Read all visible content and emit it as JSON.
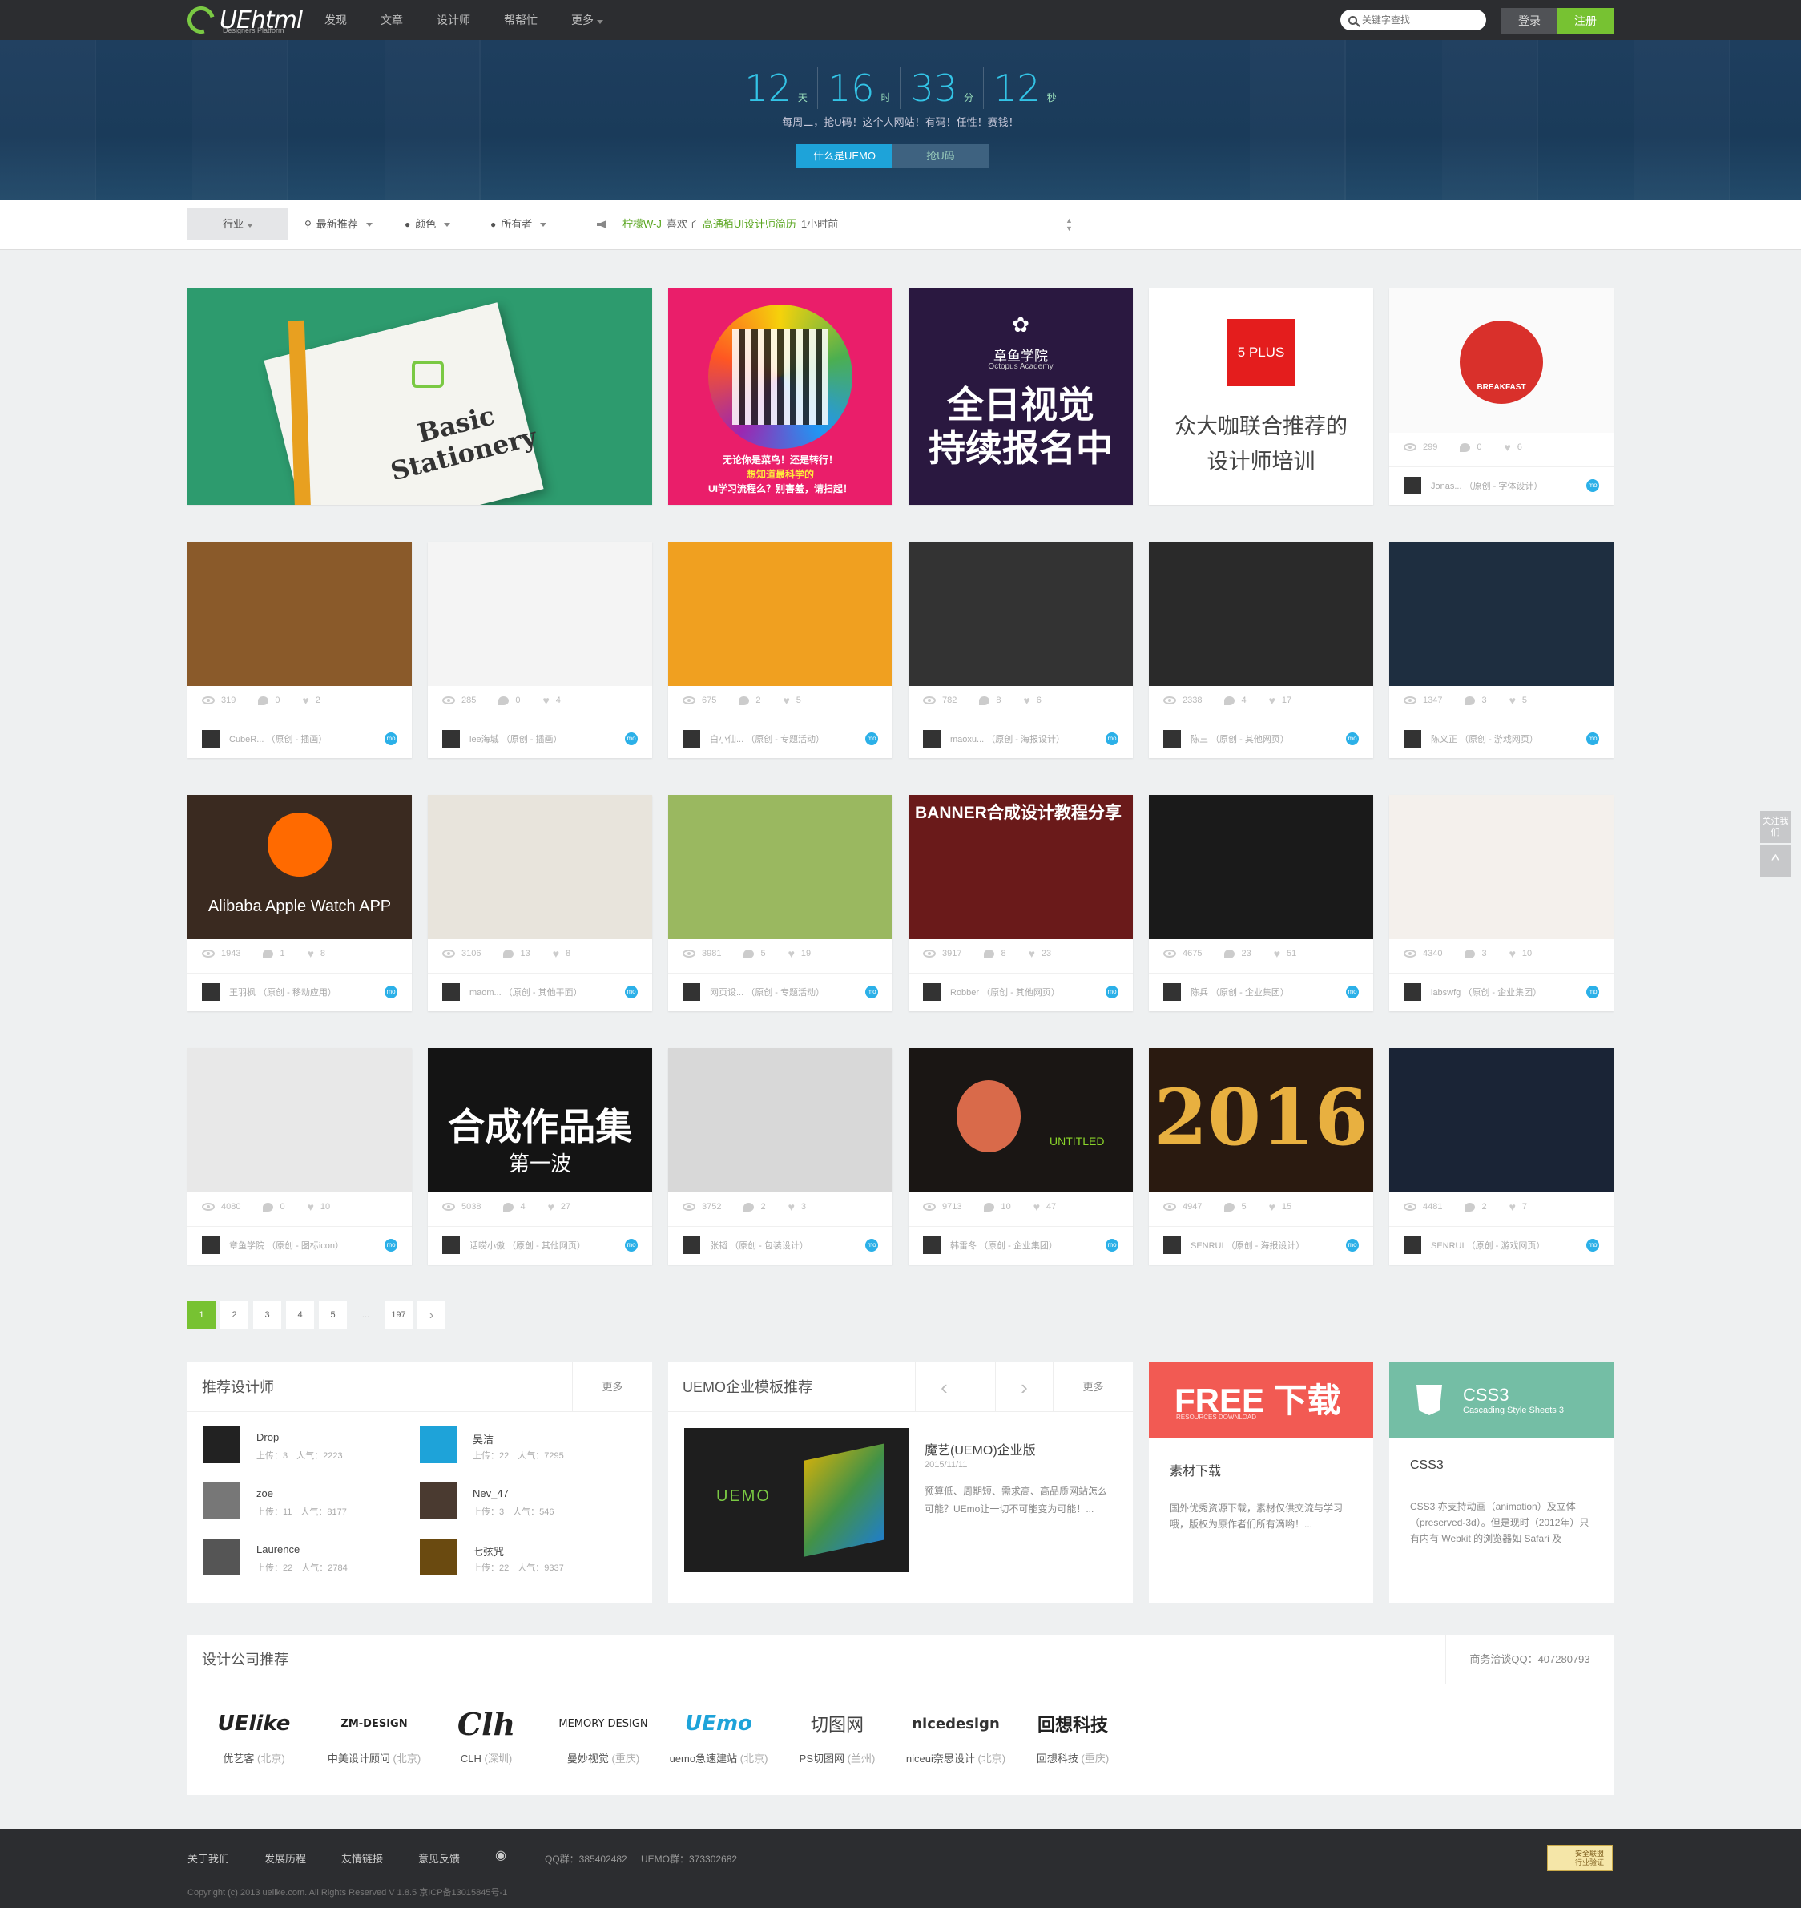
{
  "header": {
    "logo_text": "UEhtml",
    "logo_sub": "Designers Platform",
    "nav": [
      "发现",
      "文章",
      "设计师",
      "帮帮忙",
      "更多"
    ],
    "search_placeholder": "关键字查找",
    "login": "登录",
    "register": "注册"
  },
  "banner": {
    "countdown": [
      {
        "n": "12",
        "u": "天"
      },
      {
        "n": "16",
        "u": "时"
      },
      {
        "n": "33",
        "u": "分"
      },
      {
        "n": "12",
        "u": "秒"
      }
    ],
    "tagline": "每周二，抢U码！这个人网站！有码！任性！赛钱！",
    "btn_what": "什么是UEMO",
    "btn_grab": "抢U码"
  },
  "filter": {
    "industry": "行业",
    "latest": "最新推荐",
    "color": "颜色",
    "owner": "所有者",
    "activity_user": "柠檬W-J",
    "activity_verb": "喜欢了",
    "activity_item": "高通栢UI设计师简历",
    "activity_time": "1小时前"
  },
  "featured": {
    "stationery_title": "Basic Stationery",
    "qr_caption_1": "无论你是菜鸟！还是转行！",
    "qr_caption_2": "想知道最科学的",
    "qr_caption_3": "UI学习流程么？别害羞，请扫起！",
    "octopus_name": "章鱼学院",
    "octopus_en": "Octopus Academy",
    "octopus_line1": "全日视觉",
    "octopus_line2": "持续报名中",
    "plus_badge": "5 PLUS",
    "plus_line1": "众大咖联合推荐的",
    "plus_line2": "设计师培训",
    "breakfast_label": "BREAKFAST",
    "breakfast_stats": {
      "views": "299",
      "comments": "0",
      "likes": "6"
    },
    "breakfast_meta": {
      "author": "Jonas...",
      "tag": "（原创 - 字体设计）"
    }
  },
  "cards": [
    {
      "views": "319",
      "comments": "0",
      "likes": "2",
      "author": "CubeR...",
      "tag": "（原创 - 插画）",
      "color": "#8a5a2a"
    },
    {
      "views": "285",
      "comments": "0",
      "likes": "4",
      "author": "lee海城",
      "tag": "（原创 - 插画）",
      "color": "#f4f4f4"
    },
    {
      "views": "675",
      "comments": "2",
      "likes": "5",
      "author": "白小仙...",
      "tag": "（原创 - 专题活动）",
      "color": "#f0a020"
    },
    {
      "views": "782",
      "comments": "8",
      "likes": "6",
      "author": "maoxu...",
      "tag": "（原创 - 海报设计）",
      "color": "#333"
    },
    {
      "views": "2338",
      "comments": "4",
      "likes": "17",
      "author": "陈三",
      "tag": "（原创 - 其他网页）",
      "color": "#2a2a2a"
    },
    {
      "views": "1347",
      "comments": "3",
      "likes": "5",
      "author": "陈义正",
      "tag": "（原创 - 游戏网页）",
      "color": "#1e2e40"
    },
    {
      "views": "1943",
      "comments": "1",
      "likes": "8",
      "author": "王羽枫",
      "tag": "（原创 - 移动应用）",
      "color": "#3a2a20"
    },
    {
      "views": "3106",
      "comments": "13",
      "likes": "8",
      "author": "maom...",
      "tag": "（原创 - 其他平面）",
      "color": "#e8e4dc"
    },
    {
      "views": "3981",
      "comments": "5",
      "likes": "19",
      "author": "网页设...",
      "tag": "（原创 - 专题活动）",
      "color": "#9ab860"
    },
    {
      "views": "3917",
      "comments": "8",
      "likes": "23",
      "author": "Robber",
      "tag": "（原创 - 其他网页）",
      "color": "#6a1a1a"
    },
    {
      "views": "4675",
      "comments": "23",
      "likes": "51",
      "author": "陈兵",
      "tag": "（原创 - 企业集团）",
      "color": "#1a1a1a"
    },
    {
      "views": "4340",
      "comments": "3",
      "likes": "10",
      "author": "iabswfg",
      "tag": "（原创 - 企业集团）",
      "color": "#f4f0ec"
    },
    {
      "views": "4080",
      "comments": "0",
      "likes": "10",
      "author": "章鱼学院",
      "tag": "（原创 - 图标icon）",
      "color": "#e8e8e8"
    },
    {
      "views": "5038",
      "comments": "4",
      "likes": "27",
      "author": "话唠小傲",
      "tag": "（原创 - 其他网页）",
      "color": "#141414"
    },
    {
      "views": "3752",
      "comments": "2",
      "likes": "3",
      "author": "张韬",
      "tag": "（原创 - 包装设计）",
      "color": "#d8d8d8"
    },
    {
      "views": "9713",
      "comments": "10",
      "likes": "47",
      "author": "韩雷冬",
      "tag": "（原创 - 企业集团）",
      "color": "#1a1614"
    },
    {
      "views": "4947",
      "comments": "5",
      "likes": "15",
      "author": "SENRUI",
      "tag": "（原创 - 海报设计）",
      "color": "#2a1a10"
    },
    {
      "views": "4481",
      "comments": "2",
      "likes": "7",
      "author": "SENRUI",
      "tag": "（原创 - 游戏网页）",
      "color": "#1a2436"
    }
  ],
  "card_texts": {
    "alibaba": "Alibaba Apple Watch APP",
    "banner_tut": "BANNER合成设计教程分享",
    "synth_1": "合成作品集",
    "synth_2": "第一波",
    "untitled": "UNTITLED",
    "year": "2016"
  },
  "pager": [
    "1",
    "2",
    "3",
    "4",
    "5",
    "...",
    "197"
  ],
  "designers_panel": {
    "title": "推荐设计师",
    "more": "更多",
    "items": [
      {
        "name": "Drop",
        "info": "上传：3　人气：2223"
      },
      {
        "name": "吴洁",
        "info": "上传：22　人气：7295"
      },
      {
        "name": "zoe",
        "info": "上传：11　人气：8177"
      },
      {
        "name": "Nev_47",
        "info": "上传：3　人气：546"
      },
      {
        "name": "Laurence",
        "info": "上传：22　人气：2784"
      },
      {
        "name": "七弦咒",
        "info": "上传：22　人气：9337"
      }
    ]
  },
  "uemo_panel": {
    "title": "UEMO企业模板推荐",
    "more": "更多",
    "item_title": "魔艺(UEMO)企业版",
    "item_date": "2015/11/11",
    "item_desc": "预算低、周期短、需求高、高品质网站怎么可能？UEmo让一切不可能变为可能！...",
    "logo": "UEMO"
  },
  "free_panel": {
    "banner_big": "FREE 下载",
    "banner_small": "RESOURCES DOWNLOAD",
    "title": "素材下载",
    "desc": "国外优秀资源下载，素材仅供交流与学习哦，版权为原作者们所有滴哟！..."
  },
  "css3_panel": {
    "banner_big": "CSS3",
    "banner_small": "Cascading Style Sheets 3",
    "title": "CSS3",
    "desc": "CSS3 亦支持动画（animation）及立体（preserved-3d）。但是现时（2012年）只有内有 Webkit 的浏览器如 Safari 及"
  },
  "companies": {
    "title": "设计公司推荐",
    "contact": "商务洽谈QQ：407280793",
    "items": [
      {
        "logo": "UElike",
        "name": "优艺客",
        "city": "(北京)"
      },
      {
        "logo": "ZM-DESIGN",
        "name": "中美设计顾问",
        "city": "(北京)"
      },
      {
        "logo": "Clh",
        "name": "CLH",
        "city": "(深圳)"
      },
      {
        "logo": "MEMORY DESIGN",
        "name": "曼妙视觉",
        "city": "(重庆)"
      },
      {
        "logo": "UEmo",
        "name": "uemo急速建站",
        "city": "(北京)"
      },
      {
        "logo": "切图网",
        "name": "PS切图网",
        "city": "(兰州)"
      },
      {
        "logo": "nicedesign",
        "name": "niceui奈思设计",
        "city": "(北京)"
      },
      {
        "logo": "回想科技",
        "name": "回想科技",
        "city": "(重庆)"
      }
    ]
  },
  "side": {
    "qr": "关注我们",
    "top": "^"
  },
  "footer": {
    "links": [
      "关于我们",
      "发展历程",
      "友情链接",
      "意见反馈"
    ],
    "qq": "QQ群：385402482",
    "uemo": "UEMO群：373302682",
    "copyright": "Copyright (c) 2013 uelike.com. All Rights Reserved V 1.8.5 京ICP备13015845号-1",
    "badge": "安全联盟 行业验证"
  }
}
